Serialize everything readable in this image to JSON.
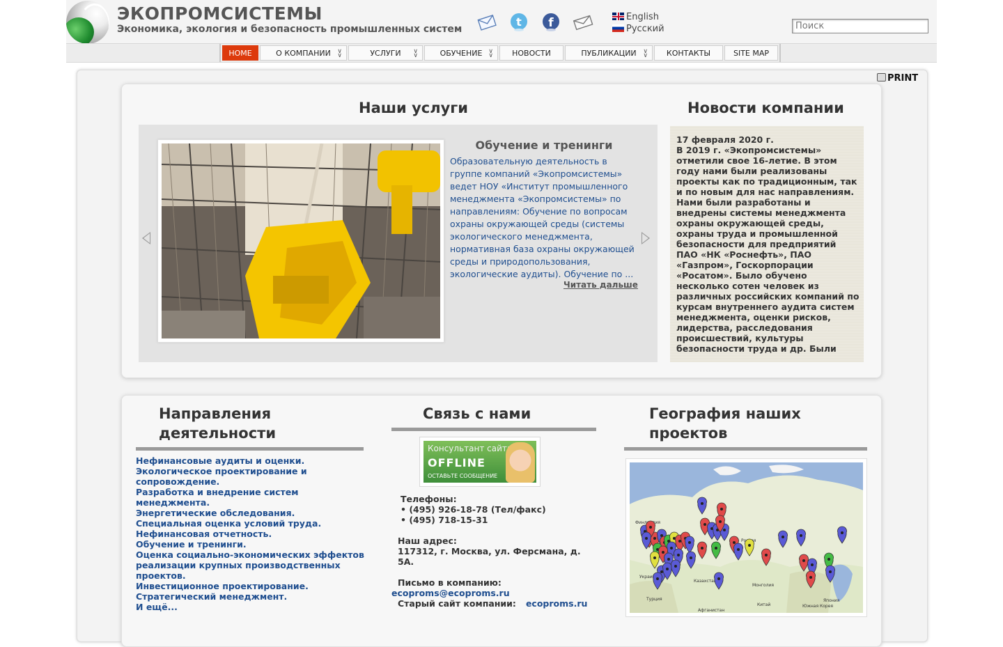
{
  "header": {
    "title": "ЭКОПРОМСИСТЕМЫ",
    "subtitle": "Экономика, экология и безопасность промышленных систем",
    "social_icons": [
      "mail-icon",
      "twitter-icon",
      "facebook-icon",
      "envelope-icon"
    ],
    "languages": [
      {
        "label": "English",
        "flag": "uk-flag-icon"
      },
      {
        "label": "Русский",
        "flag": "ru-flag-icon"
      }
    ],
    "search_placeholder": "Поиск"
  },
  "nav": {
    "items": [
      {
        "label": "HOME",
        "active": true,
        "dropdown": false
      },
      {
        "label": "О КОМПАНИИ",
        "active": false,
        "dropdown": true
      },
      {
        "label": "УСЛУГИ",
        "active": false,
        "dropdown": true
      },
      {
        "label": "ОБУЧЕНИЕ",
        "active": false,
        "dropdown": true
      },
      {
        "label": "НОВОСТИ",
        "active": false,
        "dropdown": false
      },
      {
        "label": "ПУБЛИКАЦИИ",
        "active": false,
        "dropdown": true
      },
      {
        "label": "КОНТАКТЫ",
        "active": false,
        "dropdown": false
      },
      {
        "label": "SITE MAP",
        "active": false,
        "dropdown": false
      }
    ],
    "active_color": "#dd3a0c"
  },
  "print_label": "PRINT",
  "services": {
    "heading": "Наши услуги",
    "slide_title": "Обучение и тренинги",
    "slide_text": "Образовательную деятельность в группе компаний «Экопромсистемы» ведет НОУ «Институт промышленного менеджмента «Экопромсистемы» по направлениям: Обучение по вопросам охраны окружающей среды (системы экологического менеджмента, нормативная база охраны окружающей среды и природопользования, экологические аудиты). Обучение по ...",
    "read_more": "Читать дальше"
  },
  "news": {
    "heading": "Новости компании",
    "date": "17 февраля 2020 г.",
    "text": "В 2019 г. «Экопромсистемы» отметили свое 16-летие. В этом году нами были реализованы проекты как по традиционным, так и по новым для нас направлениям. Нами были разработаны и внедрены системы менеджмента охраны окружающей среды, охраны труда и промышленной безопасности для предприятий ПАО «НК «Роснефть», ПАО «Газпром», Госкорпорации «Росатом». Было обучено несколько сотен человек из различных российских компаний по курсам внутреннего аудита систем менеджмента, оценки рисков, лидерства, расследования происшествий, культуры безопасности труда и др. Были"
  },
  "directions": {
    "heading": "Направления деятельности",
    "items": [
      "Нефинансовые аудиты и оценки.",
      "Экологическое проектирование и сопровождение.",
      "Разработка и внедрение систем менеджмента.",
      "Энергетические обследования.",
      "Специальная оценка условий труда.",
      "Нефинансовая отчетность.",
      "Обучение и тренинги.",
      "Оценка социально-экономических эффектов реализации крупных производственных проектов.",
      "Инвестиционное проектирование.",
      "Стратегический менеджмент.",
      "И ещё..."
    ]
  },
  "contact": {
    "heading": "Связь с нами",
    "widget_title": "Консультант сайта",
    "widget_status": "OFFLINE",
    "widget_sub": "ОСТАВЬТЕ СООБЩЕНИЕ",
    "phones_label": "Телефоны:",
    "phones": [
      "• (495) 926-18-78 (Тел/факс)",
      "• (495) 718-15-31"
    ],
    "address_label": "Наш адрес:",
    "address": "117312, г. Москва, ул. Ферсмана, д. 5А.",
    "mail_label": "Письмо в компанию:",
    "email": "ecoproms@ecoproms.ru",
    "old_site_label": "Старый сайт компании:",
    "old_site": "ecoproms.ru"
  },
  "geography": {
    "heading": "География наших проектов",
    "map_labels": [
      "Россия",
      "Казахстан",
      "Монголия",
      "Китай",
      "Япония",
      "Южная Корея",
      "Турция",
      "Украина",
      "Афганистан"
    ]
  },
  "colors": {
    "link": "#1f4e8f",
    "text": "#333333"
  }
}
